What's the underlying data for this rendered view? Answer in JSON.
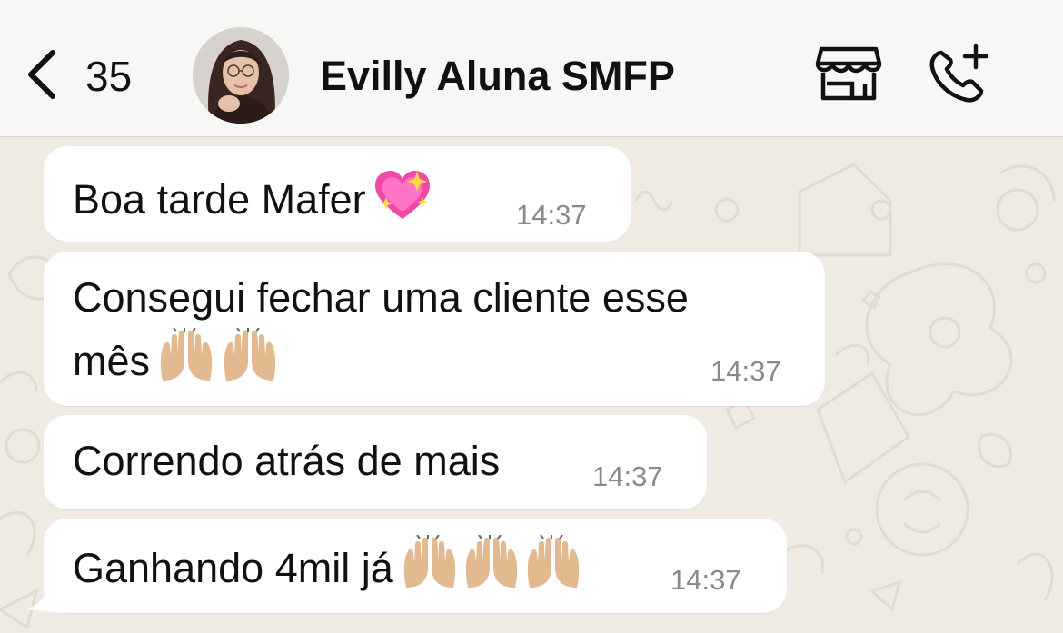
{
  "header": {
    "back_count": "35",
    "contact_name": "Evilly Aluna SMFP",
    "back_icon": "chevron-left-icon",
    "store_icon": "storefront-icon",
    "call_icon": "add-call-icon"
  },
  "messages": [
    {
      "text": "Boa tarde Mafer",
      "emoji": "sparkling-heart",
      "time": "14:37"
    },
    {
      "text_line1": "Consegui fechar uma cliente esse",
      "text_line2": "mês",
      "emoji": "raising-hands x2",
      "time": "14:37"
    },
    {
      "text": "Correndo atrás de mais",
      "time": "14:37"
    },
    {
      "text": "Ganhando 4mil já",
      "emoji": "raising-hands x3",
      "time": "14:37"
    }
  ],
  "colors": {
    "header_bg": "#f7f7f5",
    "chat_bg": "#efeae2",
    "bubble_bg": "#ffffff",
    "text": "#111111",
    "time_text": "#8a8a8a"
  }
}
